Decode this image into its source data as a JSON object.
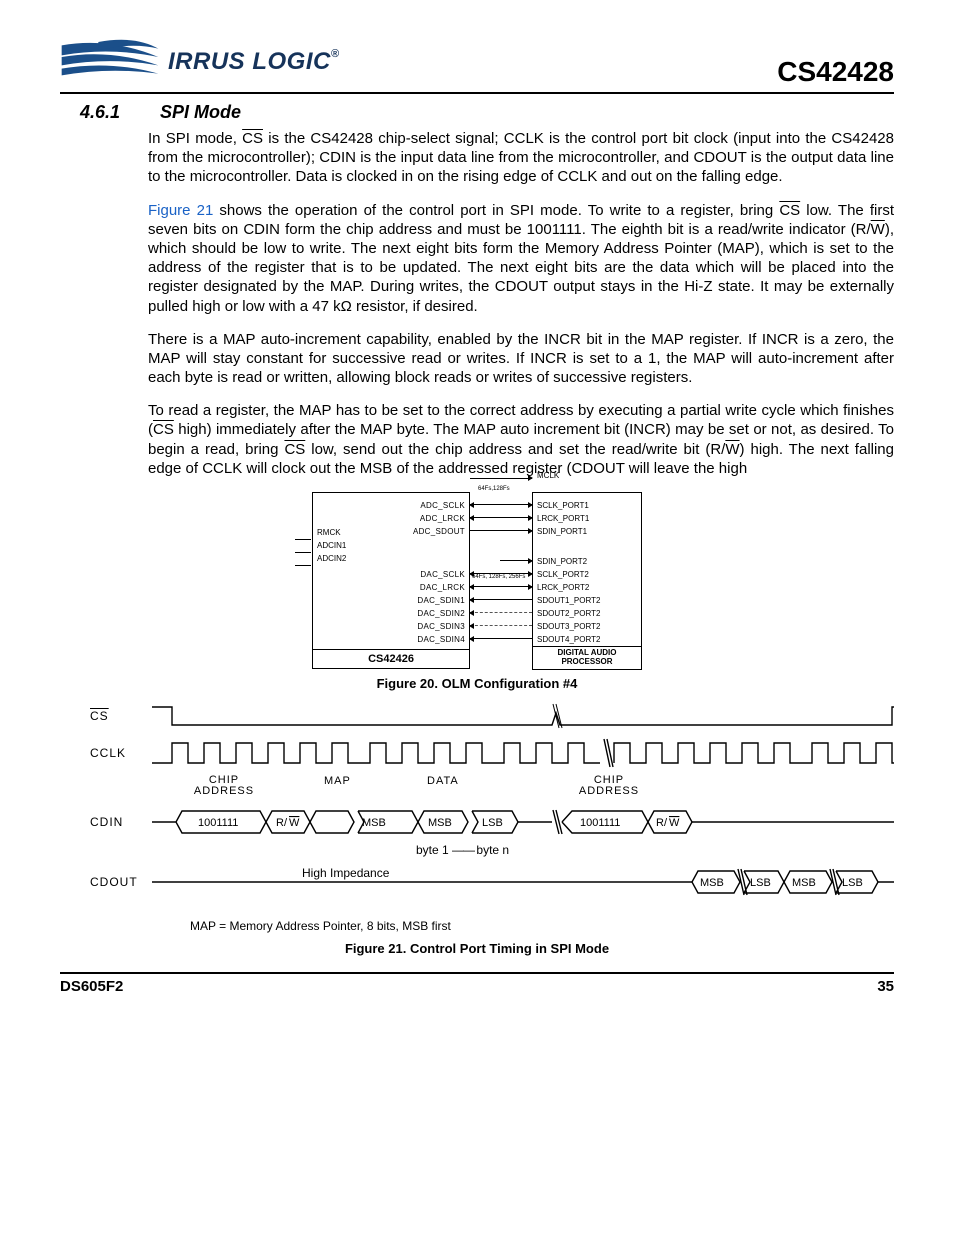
{
  "header": {
    "brand_text": "IRRUS LOGIC",
    "reg": "®",
    "part": "CS42428"
  },
  "section": {
    "num": "4.6.1",
    "title": "SPI Mode"
  },
  "paragraphs": {
    "p1a": "In SPI mode, ",
    "p1_cs": "CS",
    "p1b": " is the CS42428 chip-select signal; CCLK is the control port bit clock (input into the CS42428 from the microcontroller); CDIN is the input data line from the microcontroller, and CDOUT is the output data line to the microcontroller. Data is clocked in on the rising edge of CCLK and out on the falling edge.",
    "p2a": "Figure 21",
    "p2b": " shows the operation of the control port in SPI mode. To write to a register, bring ",
    "p2_cs": "CS",
    "p2c": " low. The first seven bits on CDIN form the chip address and must be 1001111. The eighth bit is a read/write indicator (R/",
    "p2_w": "W",
    "p2d": "), which should be low to write. The next eight bits form the Memory Address Pointer (MAP), which is set to the address of the register that is to be updated. The next eight bits are the data which will be placed into the register designated by the MAP. During writes, the CDOUT output stays in the Hi-Z state. It may be externally pulled high or low with a 47 kΩ resistor, if desired.",
    "p3": "There is a MAP auto-increment capability, enabled by the INCR bit in the MAP register. If INCR is a zero, the MAP will stay constant for successive read or writes. If INCR is set to a 1, the MAP will auto-increment after each byte is read or written, allowing block reads or writes of successive registers.",
    "p4a": "To read a register, the MAP has to be set to the correct address by executing a partial write cycle which finishes (",
    "p4_cs1": "CS",
    "p4b": " high) immediately after the MAP byte. The MAP auto increment bit (INCR) may be set or not, as desired. To begin a read, bring ",
    "p4_cs2": "CS",
    "p4c": " low, send out the chip address and set the read/write bit (R/",
    "p4_w": "W",
    "p4d": ") high. The next falling edge of CCLK will clock out the MSB of the addressed register (CDOUT will leave the high"
  },
  "fig20": {
    "caption": "Figure 20.  OLM Configuration #4",
    "left_block_title": "CS42426",
    "right_block_title": "DIGITAL AUDIO PROCESSOR",
    "rate1": "64Fs,128Fs",
    "rate2": "64Fs, 128Fs, 256Fs",
    "left_inputs": [
      "RMCK",
      "ADCIN1",
      "ADCIN2"
    ],
    "top_right": "MCLK",
    "group1": [
      {
        "l": "ADC_SCLK",
        "r": "SCLK_PORT1",
        "dir": "lr"
      },
      {
        "l": "ADC_LRCK",
        "r": "LRCK_PORT1",
        "dir": "lr"
      },
      {
        "l": "ADC_SDOUT",
        "r": "SDIN_PORT1",
        "dir": "r"
      }
    ],
    "group2_top": {
      "l": "",
      "r": "SDIN_PORT2"
    },
    "group2": [
      {
        "l": "DAC_SCLK",
        "r": "SCLK_PORT2",
        "dir": "lr"
      },
      {
        "l": "DAC_LRCK",
        "r": "LRCK_PORT2",
        "dir": "lr"
      },
      {
        "l": "DAC_SDIN1",
        "r": "SDOUT1_PORT2",
        "dir": "l"
      },
      {
        "l": "DAC_SDIN2",
        "r": "SDOUT2_PORT2",
        "dir": "l",
        "dash": true
      },
      {
        "l": "DAC_SDIN3",
        "r": "SDOUT3_PORT2",
        "dir": "l",
        "dash": true
      },
      {
        "l": "DAC_SDIN4",
        "r": "SDOUT4_PORT2",
        "dir": "l"
      }
    ]
  },
  "fig21": {
    "caption": "Figure 21.  Control Port Timing in SPI Mode",
    "signals": {
      "cs": "CS",
      "cclk": "CCLK",
      "cdin": "CDIN",
      "cdout": "CDOUT"
    },
    "labels": {
      "chip_addr": "CHIP ADDRESS",
      "chip_addr2": "CHIP ADDRESS",
      "map": "MAP",
      "data": "DATA",
      "addr_bits": "1001111",
      "rw": "R/W",
      "msb": "MSB",
      "lsb": "LSB",
      "byte1": "byte 1",
      "byten": "byte n",
      "hiz": "High Impedance"
    },
    "note": "MAP = Memory Address Pointer, 8 bits, MSB first"
  },
  "footer": {
    "doc": "DS605F2",
    "page": "35"
  }
}
